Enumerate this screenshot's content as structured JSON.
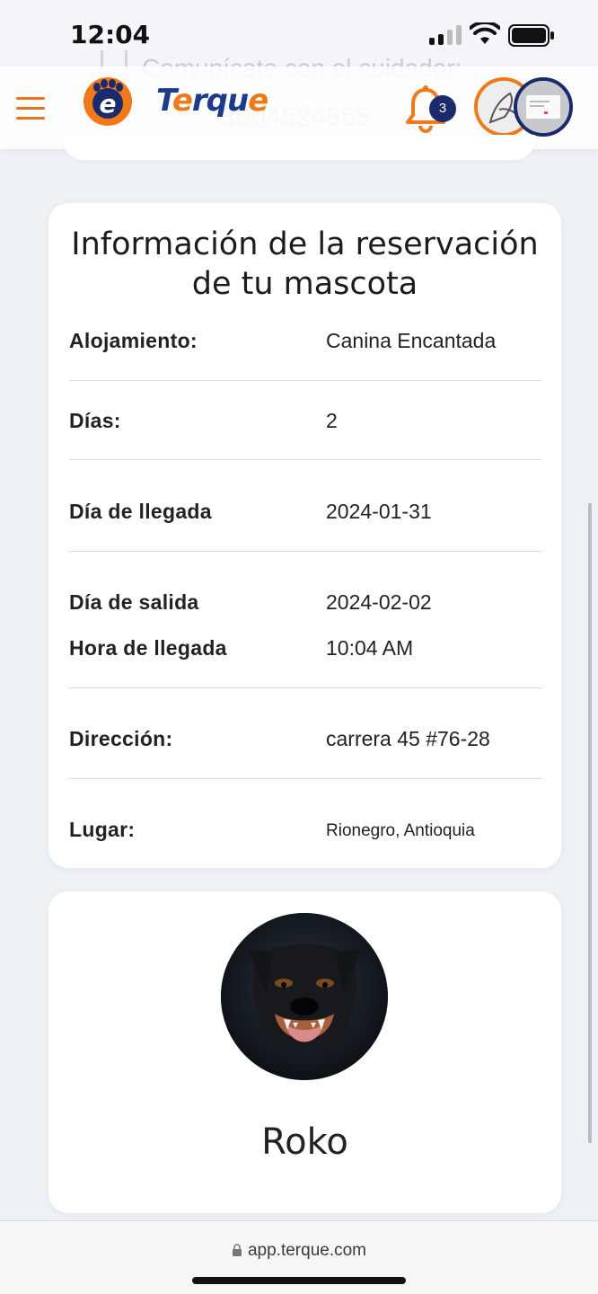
{
  "status_bar": {
    "time": "12:04"
  },
  "ghost_text": {
    "line1": "Comunícate con el cuidador:",
    "line2": "3004524565"
  },
  "header": {
    "logo_letter": "e",
    "logo_name_a": "T",
    "logo_name_b": "e",
    "logo_name_c": "rqu",
    "logo_name_d": "e",
    "notification_count": "3",
    "colors": {
      "brand_orange": "#f07a1a",
      "brand_navy": "#1a2a6a"
    }
  },
  "reservation": {
    "title": "Información de la reservación de tu mascota",
    "rows": [
      {
        "label": "Alojamiento:",
        "value": "Canina Encantada"
      },
      {
        "label": "Días:",
        "value": "2"
      },
      {
        "label": "Día de llegada",
        "value": "2024-01-31"
      },
      {
        "label": "Día de salida",
        "value": "2024-02-02"
      },
      {
        "label": "Hora de llegada",
        "value": "10:04 AM"
      },
      {
        "label": "Dirección:",
        "value": "carrera 45 #76-28"
      },
      {
        "label": "Lugar:",
        "value": "Rionegro, Antioquia"
      }
    ]
  },
  "pet": {
    "name": "Roko"
  },
  "browser": {
    "url": "app.terque.com"
  }
}
